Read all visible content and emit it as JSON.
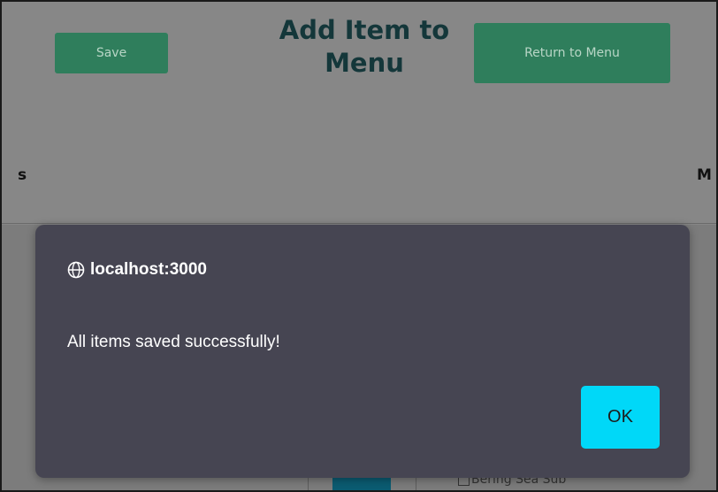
{
  "header": {
    "title": "Add Item to Menu",
    "save_label": "Save",
    "return_label": "Return to Menu",
    "col_left_fragment": "s",
    "col_right_fragment": "M"
  },
  "background": {
    "list_item_fragment": "Bering Sea Sub"
  },
  "dialog": {
    "origin": "localhost:3000",
    "message": "All items saved successfully!",
    "ok_label": "OK"
  },
  "icons": {
    "origin_icon": "globe-icon"
  },
  "colors": {
    "accent_green": "#2f7e5c",
    "title_color": "#14373a",
    "dialog_bg": "#464552",
    "ok_button": "#00d8f8"
  }
}
